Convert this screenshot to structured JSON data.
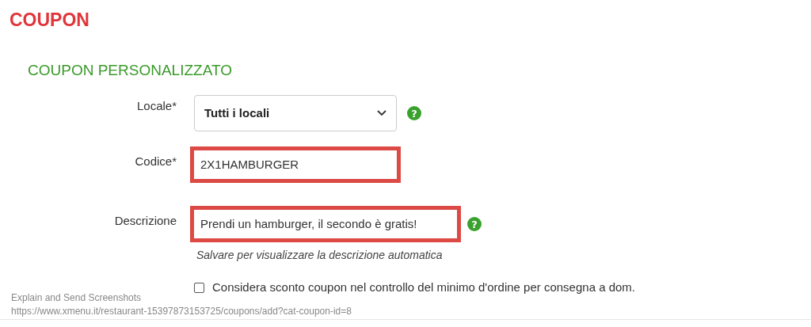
{
  "page_title": "COUPON",
  "section_title": "COUPON PERSONALIZZATO",
  "fields": [
    {
      "kind": "select",
      "label": "Locale*",
      "value": "Tutti i locali",
      "help": "?",
      "highlighted": false
    },
    {
      "kind": "text",
      "label": "Codice*",
      "value": "2X1HAMBURGER",
      "highlighted": true
    },
    {
      "kind": "text",
      "label": "Descrizione",
      "value": "Prendi un hamburger, il secondo è gratis!",
      "help": "?",
      "highlighted": true,
      "hint": "Salvare per visualizzare la descrizione automatica"
    }
  ],
  "checkbox": {
    "label": "Considera sconto coupon nel controllo del minimo d'ordine per consegna a dom.",
    "checked": false
  },
  "capture_caption": {
    "title": "Explain and Send Screenshots",
    "url": "https://www.xmenu.it/restaurant-15397873153725/coupons/add?cat-coupon-id=8"
  }
}
